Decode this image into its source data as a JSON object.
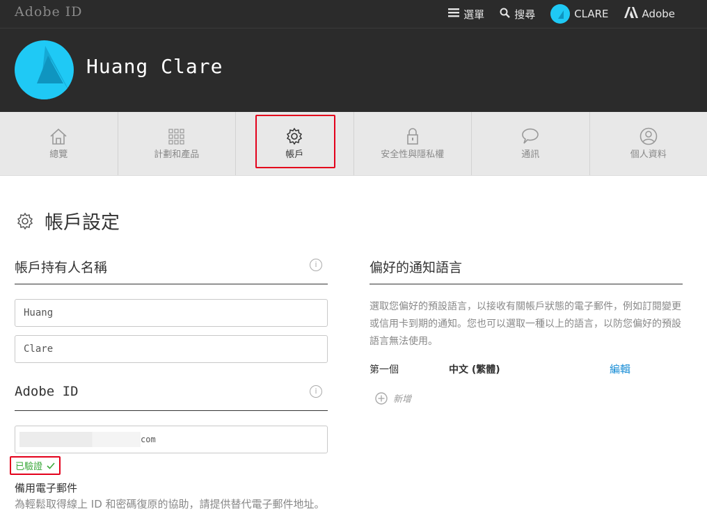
{
  "topbar": {
    "brand": "Adobe ID",
    "menu_label": "選單",
    "search_label": "搜尋",
    "user_label": "CLARE",
    "adobe_label": "Adobe"
  },
  "hero": {
    "name": "Huang Clare"
  },
  "tabs": [
    {
      "label": "總覽",
      "icon": "home-icon"
    },
    {
      "label": "計劃和產品",
      "icon": "grid-icon"
    },
    {
      "label": "帳戶",
      "icon": "gear-icon",
      "active": true
    },
    {
      "label": "安全性與隱私權",
      "icon": "lock-icon"
    },
    {
      "label": "通訊",
      "icon": "chat-bubble-icon"
    },
    {
      "label": "個人資料",
      "icon": "person-icon"
    }
  ],
  "page": {
    "title": "帳戶設定"
  },
  "account_holder": {
    "heading": "帳戶持有人名稱",
    "first_name": "Huang",
    "last_name": "Clare"
  },
  "adobe_id": {
    "heading": "Adobe ID",
    "email_suffix": "com",
    "verified_label": "已驗證"
  },
  "backup_email": {
    "heading": "備用電子郵件",
    "description": "為輕鬆取得線上 ID 和密碼復原的協助，請提供替代電子郵件地址。"
  },
  "language": {
    "heading": "偏好的通知語言",
    "description": "選取您偏好的預設語言，以接收有關帳戶狀態的電子郵件，例如訂閱變更或信用卡到期的通知。您也可以選取一種以上的語言，以防您偏好的預設語言無法使用。",
    "first_label": "第一個",
    "first_value": "中文 (繁體)",
    "edit_label": "編輯",
    "add_label": "新增"
  },
  "colors": {
    "accent": "#1fc9f5",
    "highlight": "#e3001b",
    "link": "#1a8ed6",
    "verified": "#3aa83a"
  }
}
